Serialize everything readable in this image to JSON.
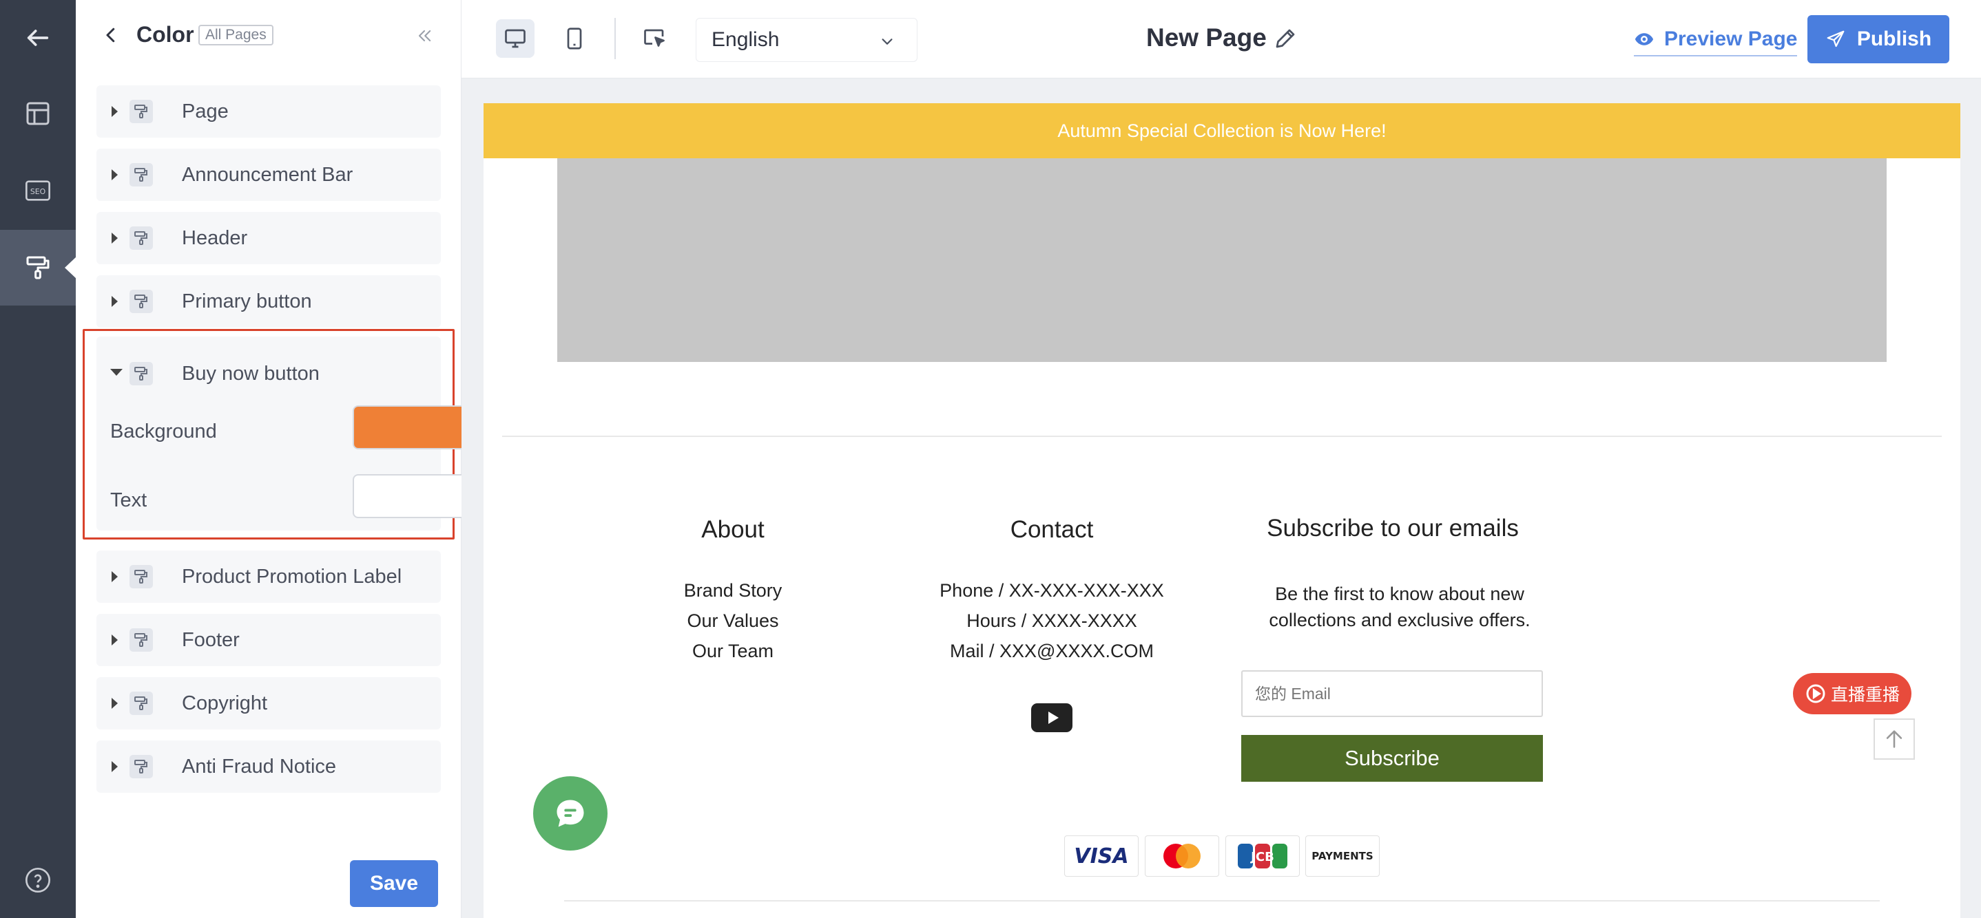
{
  "rail": {
    "items": [
      "back",
      "layout",
      "seo",
      "theme-brush",
      "help"
    ],
    "active": "theme-brush"
  },
  "panel": {
    "title": "Color",
    "scope_tag": "All Pages",
    "groups_before": [
      {
        "label": "Page"
      },
      {
        "label": "Announcement Bar"
      },
      {
        "label": "Header"
      },
      {
        "label": "Primary button"
      }
    ],
    "open_group": {
      "label": "Buy now button",
      "fields": [
        {
          "label": "Background",
          "color": "#ef8036"
        },
        {
          "label": "Text",
          "color": "#ffffff"
        }
      ]
    },
    "groups_after": [
      {
        "label": "Product Promotion Label"
      },
      {
        "label": "Footer"
      },
      {
        "label": "Copyright"
      },
      {
        "label": "Anti Fraud Notice"
      }
    ],
    "save_label": "Save"
  },
  "toolbar": {
    "language": "English",
    "page_name": "New Page",
    "preview_label": "Preview Page",
    "publish_label": "Publish"
  },
  "preview": {
    "announcement": "Autumn Special Collection is Now Here!",
    "announcement_bg": "#f5c542",
    "footer": {
      "about": {
        "heading": "About",
        "links": [
          "Brand Story",
          "Our Values",
          "Our Team"
        ]
      },
      "contact": {
        "heading": "Contact",
        "lines": [
          "Phone / XX-XXX-XXX-XXX",
          "Hours / XXXX-XXXX",
          "Mail / XXX@XXXX.COM"
        ]
      },
      "subscribe": {
        "heading": "Subscribe to our emails",
        "blurb": "Be the first to know about new collections and exclusive offers.",
        "email_placeholder": "您的 Email",
        "button": "Subscribe",
        "button_bg": "#4e6b26"
      },
      "payments": [
        "VISA",
        "Mastercard",
        "JCB",
        "PAYMENTS"
      ]
    },
    "live_badge": "直播重播"
  },
  "colors": {
    "accent": "#4a7ede",
    "rail_bg": "#363d4a",
    "highlight_border": "#d9432c"
  }
}
